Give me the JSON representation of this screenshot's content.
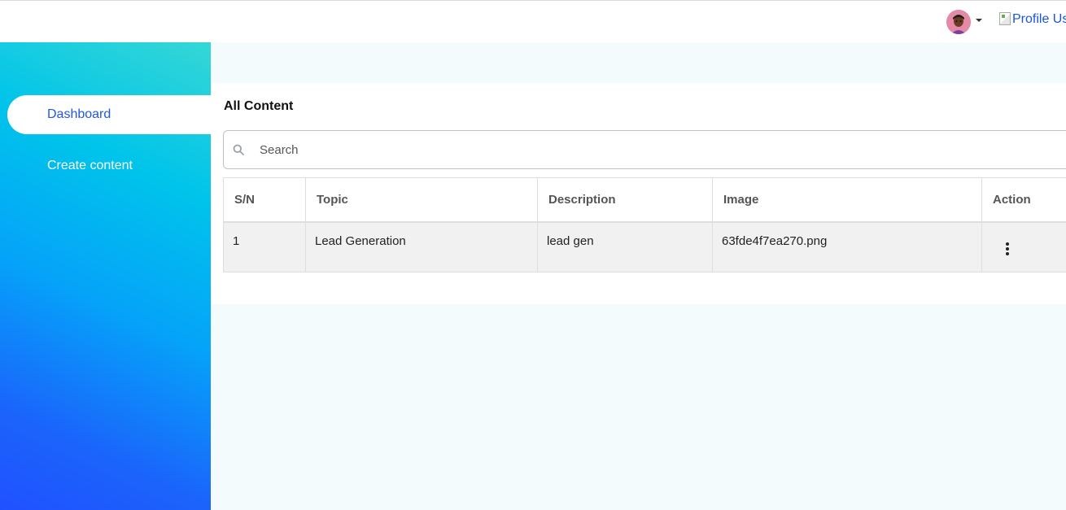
{
  "header": {
    "avatar_icon": "user-avatar-icon",
    "profile_image_alt": "Profile Us"
  },
  "sidebar": {
    "items": [
      {
        "label": "Dashboard",
        "active": true
      },
      {
        "label": "Create content",
        "active": false
      }
    ]
  },
  "main": {
    "title": "All Content",
    "search": {
      "placeholder": "Search",
      "value": ""
    },
    "table": {
      "columns": [
        "S/N",
        "Topic",
        "Description",
        "Image",
        "Action"
      ],
      "rows": [
        {
          "sn": "1",
          "topic": "Lead Generation",
          "description": "lead gen",
          "image": "63fde4f7ea270.png",
          "action_icon": "more-vertical-icon"
        }
      ]
    }
  },
  "colors": {
    "accent": "#2456e6",
    "sidebar_gradient_top": "#35d7d5",
    "sidebar_gradient_bottom": "#2051ff",
    "page_background": "#f4fbfd"
  }
}
